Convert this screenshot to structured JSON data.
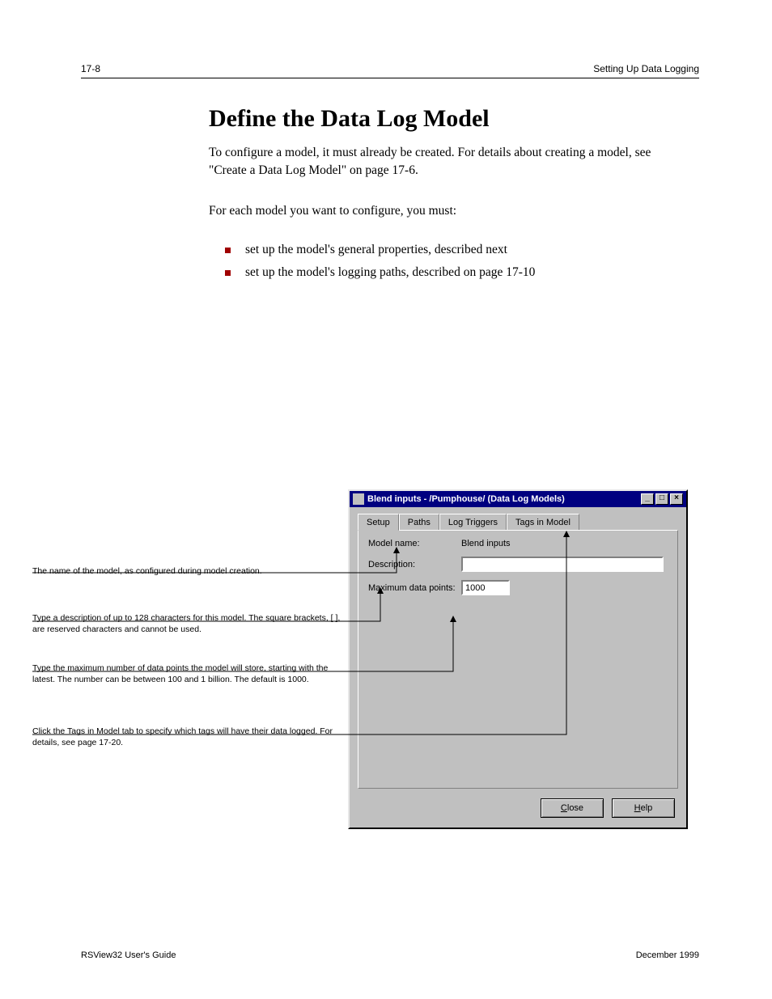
{
  "header": {
    "left": "17-8",
    "right": "Setting Up Data Logging"
  },
  "heading": "Define the Data Log Model",
  "paragraphs": [
    "To configure a model, it must already be created. For details about creating a model, see \"Create a Data Log Model\" on page 17-6.",
    "For each model you want to configure, you must:"
  ],
  "bullets": [
    "set up the model's general properties, described next",
    "set up the model's logging paths, described on page 17-10"
  ],
  "callouts": [
    "The name of the model, as configured during model creation.",
    "Type a description of up to 128 characters for this model. The square brackets, [ ], are reserved characters and cannot be used.",
    "Type the maximum number of data points the model will store, starting with the latest. The number can be between 100 and 1 billion. The default is 1000.",
    "Click the Tags in Model tab to specify which tags will have their data logged. For details, see page 17-20."
  ],
  "dialog": {
    "title": "Blend inputs - /Pumphouse/ (Data Log Models)",
    "tabs": [
      "Setup",
      "Paths",
      "Log Triggers",
      "Tags in Model"
    ],
    "model_name_label": "Model name:",
    "model_name_value": "Blend inputs",
    "description_label": "Description:",
    "description_value": "",
    "max_points_label": "Maximum data points:",
    "max_points_value": "1000",
    "close_label": "Close",
    "help_label": "Help"
  },
  "footer": {
    "left": "RSView32 User's Guide",
    "right": "December 1999"
  }
}
